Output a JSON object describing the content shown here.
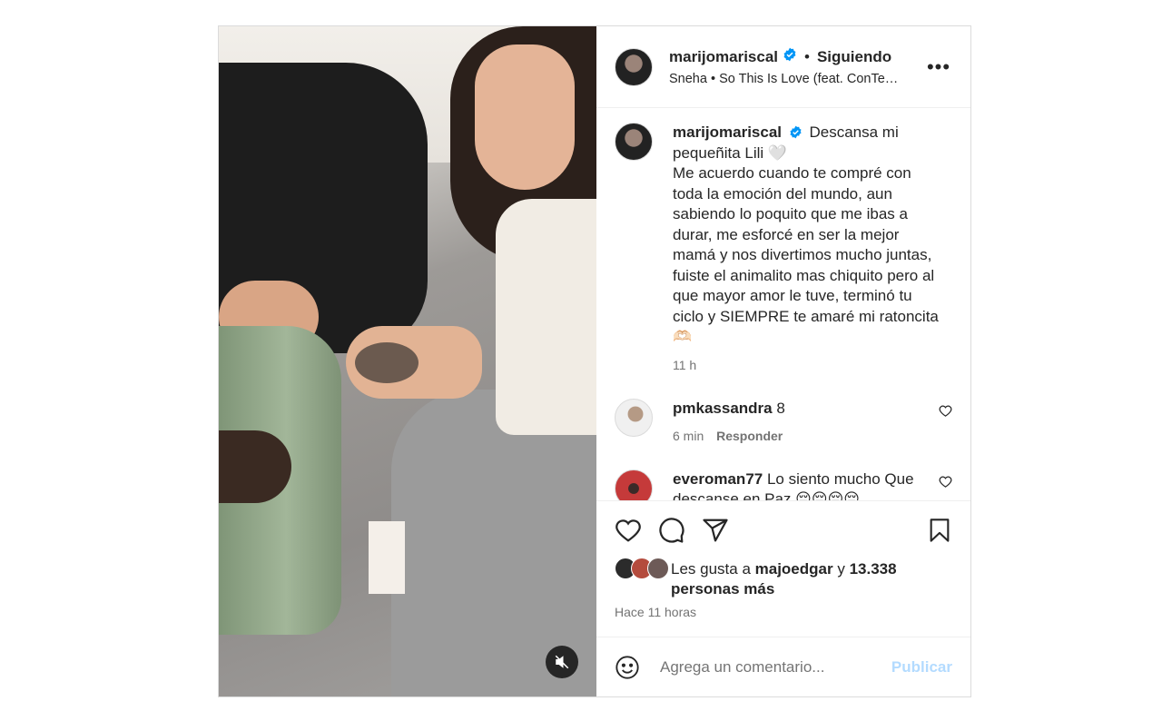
{
  "post": {
    "author": {
      "username": "marijomariscal",
      "verified": true,
      "follow_status": "Siguiendo"
    },
    "audio": {
      "artist": "Sneha",
      "song": "So This Is Love (feat. ConTe…"
    },
    "caption": {
      "username": "marijomariscal",
      "text": "Descansa mi pequeñita Lili 🤍\nMe acuerdo cuando te compré con toda la emoción del mundo, aun sabiendo lo poquito que me ibas a durar, me esforcé en ser la mejor mamá y nos divertimos mucho juntas, fuiste el animalito mas chiquito pero al que mayor amor le tuve, terminó tu ciclo y SIEMPRE te amaré mi ratoncita 🫶🏻",
      "time": "11 h"
    },
    "comments": [
      {
        "username": "pmkassandra",
        "text": "8",
        "time": "6 min",
        "reply_label": "Responder"
      },
      {
        "username": "everoman77",
        "text": "Lo siento mucho Que descanse en Paz 😔😔😔😔",
        "time": "",
        "reply_label": ""
      }
    ],
    "likes": {
      "prefix": "Les gusta a ",
      "liker": "majoedgar",
      "middle": " y ",
      "count": "13.338",
      "suffix": "personas más"
    },
    "posted_ago": "Hace 11 horas",
    "comment_box": {
      "placeholder": "Agrega un comentario...",
      "publish_label": "Publicar"
    }
  },
  "icons": {
    "verified": "verified-badge-icon",
    "more": "more-options-icon",
    "like": "heart-icon",
    "comment": "comment-icon",
    "share": "share-icon",
    "save": "bookmark-icon",
    "mute": "muted-speaker-icon",
    "emoji": "emoji-icon"
  },
  "colors": {
    "verified_blue": "#0095f6",
    "publish_disabled": "#b3dbff",
    "secondary_text": "#737373"
  }
}
